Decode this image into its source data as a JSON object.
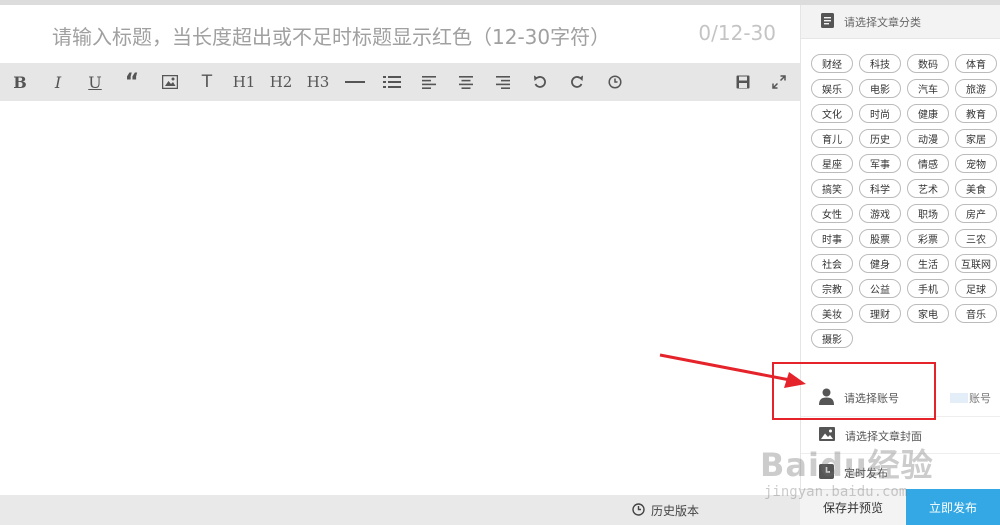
{
  "editor": {
    "title_placeholder": "请输入标题，当长度超出或不足时标题显示红色（12-30字符）",
    "title_count": "0/12-30",
    "toolbar": {
      "bold": "B",
      "italic": "I",
      "underline": "U",
      "h1": "H1",
      "h2": "H2",
      "h3": "H3"
    },
    "history_label": "历史版本"
  },
  "sidebar": {
    "category_header": "请选择文章分类",
    "tags": [
      "财经",
      "科技",
      "数码",
      "体育",
      "娱乐",
      "电影",
      "汽车",
      "旅游",
      "文化",
      "时尚",
      "健康",
      "教育",
      "育儿",
      "历史",
      "动漫",
      "家居",
      "星座",
      "军事",
      "情感",
      "宠物",
      "搞笑",
      "科学",
      "艺术",
      "美食",
      "女性",
      "游戏",
      "职场",
      "房产",
      "时事",
      "股票",
      "彩票",
      "三农",
      "社会",
      "健身",
      "生活",
      "互联网",
      "宗教",
      "公益",
      "手机",
      "足球",
      "美妆",
      "理财",
      "家电",
      "音乐",
      "摄影"
    ],
    "account_label": "请选择账号",
    "account_suffix": "账号",
    "cover_label": "请选择文章封面",
    "timer_label": "定时发布",
    "save_button": "保存并预览",
    "publish_button": "立即发布"
  },
  "watermark": {
    "main": "Baidu经验",
    "sub": "jingyan.baidu.com"
  },
  "colors": {
    "publish_blue": "#33a8e4",
    "annotation_red": "#e5232b"
  },
  "icons": {
    "category": "document-icon",
    "account": "user-icon",
    "cover": "image-icon",
    "timer": "clock-icon",
    "history": "clock-icon"
  }
}
